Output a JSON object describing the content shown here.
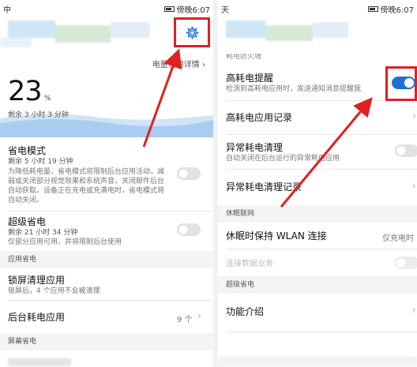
{
  "left": {
    "status": {
      "left": "中",
      "right": "傍晚6:07"
    },
    "battery_detail_link": "电量使用详情",
    "battery_percent": "23",
    "percent_sign": "%",
    "remaining": "剩余 3 小时 3 分钟",
    "power_saving": {
      "title": "省电模式",
      "remaining": "剩余 5 小时 19 分钟",
      "desc": "为降低耗电量，省电模式将限制后台应用活动，减弱或关闭部分视觉效果和系统声音，关闭邮件后台自动获取。设备正在充电或充满电时，省电模式将自动关闭。"
    },
    "super_saving": {
      "title": "超级省电",
      "remaining": "剩余 21 小时 34 分钟",
      "desc": "仅部分应用可用，并将限制后台使用"
    },
    "section_app": "应用省电",
    "lock_clean": {
      "title": "锁屏清理应用",
      "desc": "锁屏后，4 个应用不会被清理"
    },
    "bg_power": {
      "title": "后台耗电应用",
      "value": "9 个"
    },
    "section_screen": "屏幕省电"
  },
  "right": {
    "status": {
      "left": "天",
      "right": "傍晚6:07"
    },
    "top_cut_text": "耗电防火墙",
    "high_power_alert": {
      "title": "高耗电提醒",
      "desc": "检测到高耗电应用时，发送通知消息提醒我"
    },
    "high_power_record": {
      "title": "高耗电应用记录"
    },
    "abnormal_clean": {
      "title": "异常耗电清理",
      "desc": "自动关闭在后台运行的异常耗电应用"
    },
    "abnormal_record": {
      "title": "异常耗电清理记录"
    },
    "section_sleep": "休眠联网",
    "sleep_wlan": {
      "title": "休眠时保持 WLAN 连接",
      "value": "仅充电时"
    },
    "sleep_data": {
      "title": "连接数据业务"
    },
    "section_super": "超级省电",
    "features": {
      "title": "功能介绍"
    }
  },
  "colors": {
    "accent": "#1e6fd9",
    "highlight": "#e02020"
  },
  "icons": {
    "settings": "gear-icon",
    "arrow": "chevron-right-icon"
  }
}
